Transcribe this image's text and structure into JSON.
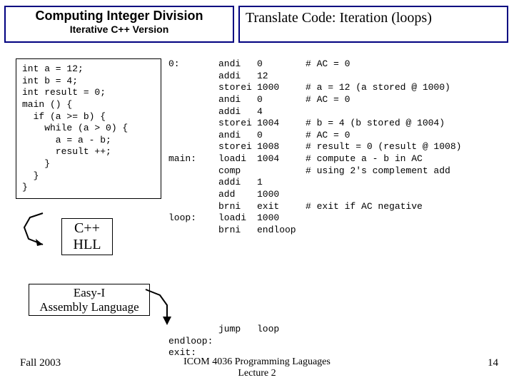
{
  "title_left_main": "Computing Integer Division",
  "title_left_sub": "Iterative C++ Version",
  "title_right": "Translate Code: Iteration (loops)",
  "cpp_code": "int a = 12;\nint b = 4;\nint result = 0;\nmain () {\n  if (a >= b) {\n    while (a > 0) {\n      a = a - b;\n      result ++;\n    }\n  }\n}",
  "asm": [
    {
      "lbl": "0:",
      "op": "andi",
      "arg": "0",
      "cmt": "# AC = 0"
    },
    {
      "lbl": "",
      "op": "addi",
      "arg": "12",
      "cmt": ""
    },
    {
      "lbl": "",
      "op": "storei",
      "arg": "1000",
      "cmt": "# a = 12 (a stored @ 1000)"
    },
    {
      "lbl": "",
      "op": "andi",
      "arg": "0",
      "cmt": "# AC = 0"
    },
    {
      "lbl": "",
      "op": "addi",
      "arg": "4",
      "cmt": ""
    },
    {
      "lbl": "",
      "op": "storei",
      "arg": "1004",
      "cmt": "# b = 4 (b stored @ 1004)"
    },
    {
      "lbl": "",
      "op": "andi",
      "arg": "0",
      "cmt": "# AC = 0"
    },
    {
      "lbl": "",
      "op": "storei",
      "arg": "1008",
      "cmt": "# result = 0 (result @ 1008)"
    },
    {
      "lbl": "main:",
      "op": "loadi",
      "arg": "1004",
      "cmt": "# compute a - b in AC"
    },
    {
      "lbl": "",
      "op": "comp",
      "arg": "",
      "cmt": "# using 2's complement add"
    },
    {
      "lbl": "",
      "op": "addi",
      "arg": "1",
      "cmt": ""
    },
    {
      "lbl": "",
      "op": "add",
      "arg": "1000",
      "cmt": ""
    },
    {
      "lbl": "",
      "op": "brni",
      "arg": "exit",
      "cmt": "# exit if AC negative"
    },
    {
      "lbl": "loop:",
      "op": "loadi",
      "arg": "1000",
      "cmt": ""
    },
    {
      "lbl": "",
      "op": "brni",
      "arg": "endloop",
      "cmt": ""
    }
  ],
  "asm_bottom": [
    {
      "lbl": "",
      "op": "jump",
      "arg": "loop"
    },
    {
      "lbl": "endloop:",
      "op": "",
      "arg": ""
    },
    {
      "lbl": "exit:",
      "op": "",
      "arg": ""
    }
  ],
  "cpp_label_l1": "C++",
  "cpp_label_l2": "HLL",
  "easyi_l1": "Easy-I",
  "easyi_l2": "Assembly Language",
  "footer_left": "Fall 2003",
  "footer_center_l1": "ICOM 4036 Programming Laguages",
  "footer_center_l2": "Lecture 2",
  "footer_right": "14"
}
